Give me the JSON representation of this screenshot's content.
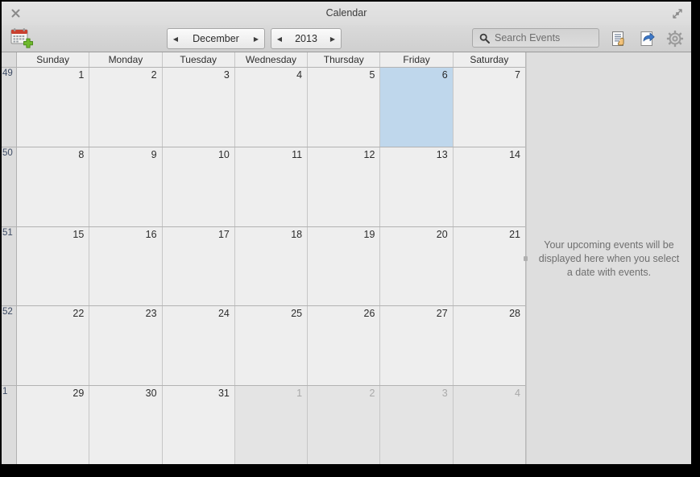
{
  "window": {
    "title": "Calendar",
    "close_icon": "close-icon",
    "maximize_icon": "maximize-restore-icon"
  },
  "toolbar": {
    "new_event_icon": "calendar-add-icon",
    "month": {
      "prev_arrow": "◀",
      "label": "December",
      "next_arrow": "▶"
    },
    "year": {
      "prev_arrow": "◀",
      "label": "2013",
      "next_arrow": "▶"
    },
    "search": {
      "icon": "search-icon",
      "value": "",
      "placeholder": "Search Events"
    },
    "list_view_icon": "list-view-icon",
    "share_icon": "share-forward-icon",
    "settings_icon": "gear-icon"
  },
  "calendar": {
    "weekday_headers": [
      "Sunday",
      "Monday",
      "Tuesday",
      "Wednesday",
      "Thursday",
      "Friday",
      "Saturday"
    ],
    "weeks": [
      {
        "week_number": "49",
        "days": [
          {
            "label": "1",
            "other_month": false,
            "selected": false
          },
          {
            "label": "2",
            "other_month": false,
            "selected": false
          },
          {
            "label": "3",
            "other_month": false,
            "selected": false
          },
          {
            "label": "4",
            "other_month": false,
            "selected": false
          },
          {
            "label": "5",
            "other_month": false,
            "selected": false
          },
          {
            "label": "6",
            "other_month": false,
            "selected": true
          },
          {
            "label": "7",
            "other_month": false,
            "selected": false
          }
        ]
      },
      {
        "week_number": "50",
        "days": [
          {
            "label": "8",
            "other_month": false,
            "selected": false
          },
          {
            "label": "9",
            "other_month": false,
            "selected": false
          },
          {
            "label": "10",
            "other_month": false,
            "selected": false
          },
          {
            "label": "11",
            "other_month": false,
            "selected": false
          },
          {
            "label": "12",
            "other_month": false,
            "selected": false
          },
          {
            "label": "13",
            "other_month": false,
            "selected": false
          },
          {
            "label": "14",
            "other_month": false,
            "selected": false
          }
        ]
      },
      {
        "week_number": "51",
        "days": [
          {
            "label": "15",
            "other_month": false,
            "selected": false
          },
          {
            "label": "16",
            "other_month": false,
            "selected": false
          },
          {
            "label": "17",
            "other_month": false,
            "selected": false
          },
          {
            "label": "18",
            "other_month": false,
            "selected": false
          },
          {
            "label": "19",
            "other_month": false,
            "selected": false
          },
          {
            "label": "20",
            "other_month": false,
            "selected": false
          },
          {
            "label": "21",
            "other_month": false,
            "selected": false
          }
        ]
      },
      {
        "week_number": "52",
        "days": [
          {
            "label": "22",
            "other_month": false,
            "selected": false
          },
          {
            "label": "23",
            "other_month": false,
            "selected": false
          },
          {
            "label": "24",
            "other_month": false,
            "selected": false
          },
          {
            "label": "25",
            "other_month": false,
            "selected": false
          },
          {
            "label": "26",
            "other_month": false,
            "selected": false
          },
          {
            "label": "27",
            "other_month": false,
            "selected": false
          },
          {
            "label": "28",
            "other_month": false,
            "selected": false
          }
        ]
      },
      {
        "week_number": "1",
        "days": [
          {
            "label": "29",
            "other_month": false,
            "selected": false
          },
          {
            "label": "30",
            "other_month": false,
            "selected": false
          },
          {
            "label": "31",
            "other_month": false,
            "selected": false
          },
          {
            "label": "1",
            "other_month": true,
            "selected": false
          },
          {
            "label": "2",
            "other_month": true,
            "selected": false
          },
          {
            "label": "3",
            "other_month": true,
            "selected": false
          },
          {
            "label": "4",
            "other_month": true,
            "selected": false
          }
        ]
      }
    ]
  },
  "sidebar": {
    "empty_message": "Your upcoming events will be displayed here when you select a date with events."
  },
  "colors": {
    "selection": "#bfd7ec",
    "window_background": "#ededed",
    "sidebar_background": "#dedede",
    "other_month_cell": "#e4e4e4"
  }
}
